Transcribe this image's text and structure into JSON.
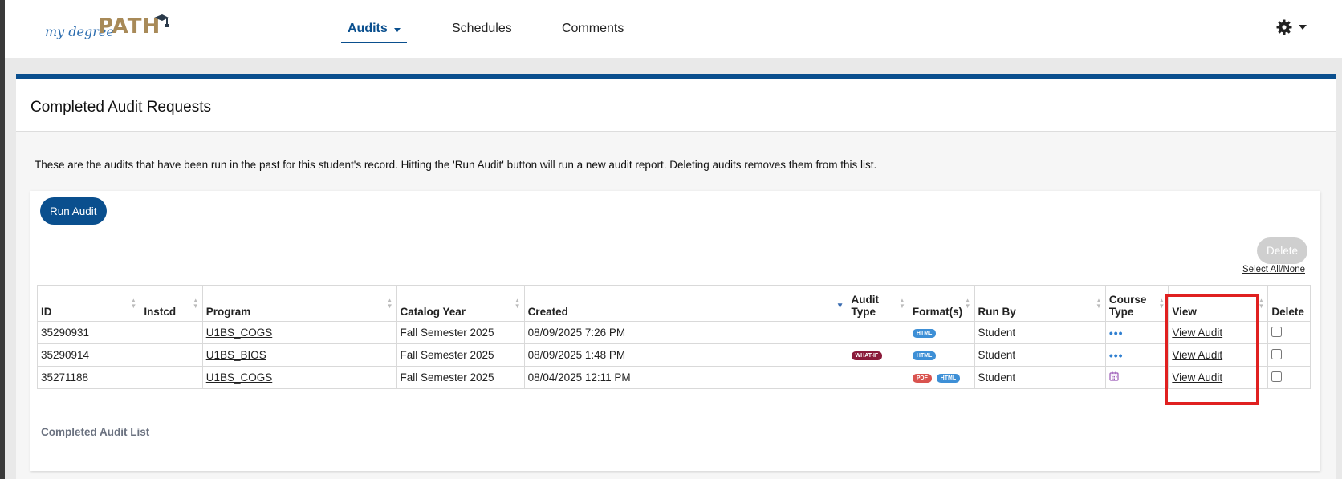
{
  "brand": {
    "script": "my degree",
    "wordmark": "PATH"
  },
  "nav": {
    "items": [
      {
        "label": "Audits"
      },
      {
        "label": "Schedules"
      },
      {
        "label": "Comments"
      }
    ]
  },
  "page": {
    "title": "Completed Audit Requests",
    "description": "These are the audits that have been run in the past for this student's record. Hitting the 'Run Audit' button will run a new audit report. Deleting audits removes them from this list."
  },
  "toolbar": {
    "run_audit_label": "Run Audit",
    "delete_label": "Delete",
    "select_all_label": "Select All/None"
  },
  "table": {
    "headers": {
      "id": "ID",
      "instcd": "Instcd",
      "program": "Program",
      "catalog_year": "Catalog Year",
      "created": "Created",
      "audit_type_1": "Audit",
      "audit_type_2": "Type",
      "formats": "Format(s)",
      "run_by": "Run By",
      "course_type_1": "Course",
      "course_type_2": "Type",
      "view": "View",
      "delete": "Delete"
    },
    "rows": [
      {
        "id": "35290931",
        "instcd": "",
        "program": "U1BS_COGS",
        "catalog_year": "Fall Semester 2025",
        "created": "08/09/2025 7:26 PM",
        "audit_type": "",
        "format_a": "HTML",
        "run_by": "Student",
        "view": "View Audit"
      },
      {
        "id": "35290914",
        "instcd": "",
        "program": "U1BS_BIOS",
        "catalog_year": "Fall Semester 2025",
        "created": "08/09/2025 1:48 PM",
        "audit_type": "WHAT-IF",
        "format_a": "HTML",
        "run_by": "Student",
        "view": "View Audit"
      },
      {
        "id": "35271188",
        "instcd": "",
        "program": "U1BS_COGS",
        "catalog_year": "Fall Semester 2025",
        "created": "08/04/2025 12:11 PM",
        "audit_type": "",
        "format_a": "PDF",
        "format_b": "HTML",
        "run_by": "Student",
        "view": "View Audit"
      }
    ]
  },
  "footer": {
    "list_label": "Completed Audit List"
  },
  "colors": {
    "primary": "#0a4f8e",
    "highlight": "#e02020",
    "brand_gold": "#a88a58",
    "badge_html": "#3d8fd6",
    "badge_pdf": "#d9534f",
    "badge_whatif": "#8b1a3a"
  }
}
